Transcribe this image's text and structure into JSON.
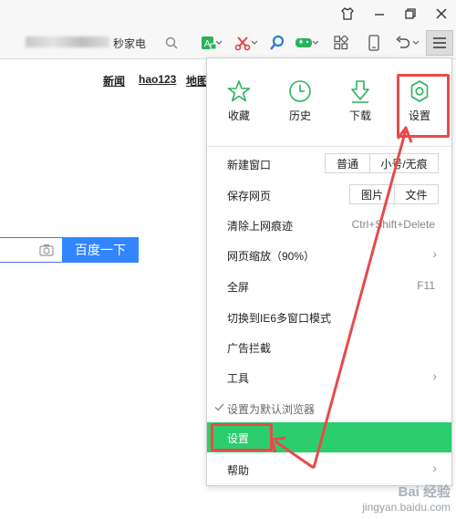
{
  "address": {
    "text": "秒家电"
  },
  "baidu": {
    "nav": [
      "新闻",
      "hao123",
      "地图"
    ],
    "search_button": "百度一下"
  },
  "menu": {
    "quick": [
      {
        "label": "收藏",
        "icon": "star-icon"
      },
      {
        "label": "历史",
        "icon": "clock-icon"
      },
      {
        "label": "下载",
        "icon": "download-icon"
      },
      {
        "label": "设置",
        "icon": "gear-icon"
      }
    ],
    "new_window": {
      "label": "新建窗口",
      "normal": "普通",
      "incognito": "小号/无痕"
    },
    "save_page": {
      "label": "保存网页",
      "image": "图片",
      "file": "文件"
    },
    "clear_trace": {
      "label": "清除上网痕迹",
      "shortcut": "Ctrl+Shift+Delete"
    },
    "zoom": {
      "label": "网页缩放（90%）"
    },
    "fullscreen": {
      "label": "全屏",
      "shortcut": "F11"
    },
    "ie6_mode": {
      "label": "切换到IE6多窗口模式"
    },
    "ad_block": {
      "label": "广告拦截"
    },
    "tools": {
      "label": "工具"
    },
    "default_browser": {
      "label": "设置为默认浏览器"
    },
    "settings": {
      "label": "设置"
    },
    "help": {
      "label": "帮助"
    }
  },
  "watermark": {
    "line1": "Bai 经验",
    "line2": "jingyan.baidu.com"
  },
  "colors": {
    "menu_active": "#2ccd6c",
    "annotation_red": "#e84a4a",
    "baidu_blue": "#3385ff",
    "icon_green": "#2ab35e"
  }
}
